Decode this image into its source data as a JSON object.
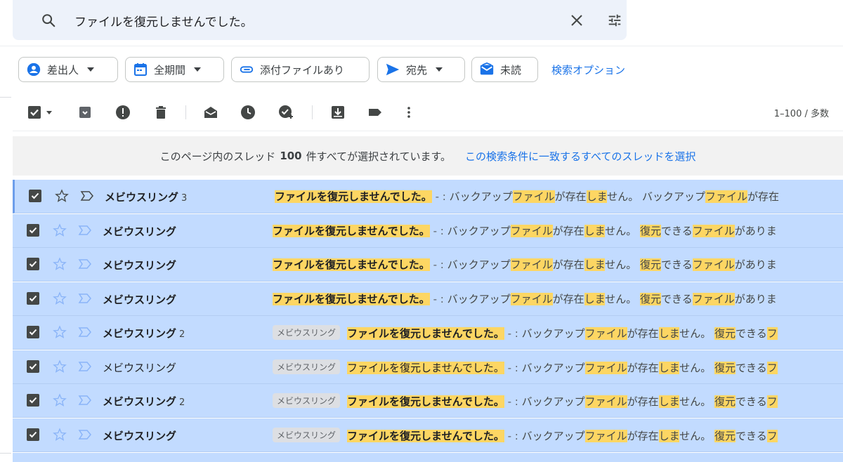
{
  "search": {
    "query": "ファイルを復元しませんでした。"
  },
  "chips": {
    "from": "差出人",
    "date": "全期間",
    "attachment": "添付ファイルあり",
    "to": "宛先",
    "unread": "未読"
  },
  "search_options": "検索オプション",
  "toolbar": {
    "range": "1–100 / 多数"
  },
  "banner": {
    "prefix": "このページ内のスレッド",
    "count": "100",
    "suffix": "件すべてが選択されています。",
    "select_all": "この検索条件に一致するすべてのスレッドを選択"
  },
  "rows": [
    {
      "sender": "メビウスリング",
      "count": "3",
      "bold": true,
      "label": "",
      "subject": "ファイルを復元しませんでした。",
      "dash": " - : ",
      "snippet_a": "バックアップ",
      "kw1": "ファイル",
      "snippet_b": "が存在",
      "kw2": "しま",
      "snippet_c": "せ",
      "snippet_d": "ん。 バックアップ",
      "kw3": "ファイル",
      "snippet_e": "が存在"
    },
    {
      "sender": "メビウスリング",
      "count": "",
      "bold": true,
      "label": "",
      "subject": "ファイルを復元しませんでした。",
      "dash": " - : ",
      "snippet_a": "バックアップ",
      "kw1": "ファイル",
      "snippet_b": "が存在",
      "kw2": "しま",
      "snippet_c": "せ",
      "snippet_d": "ん。 ",
      "kw3": "復元",
      "snippet_e": "できる",
      "kw4": "ファイル",
      "snippet_f": "がありま"
    },
    {
      "sender": "メビウスリング",
      "count": "",
      "bold": true,
      "label": "",
      "subject": "ファイルを復元しませんでした。",
      "dash": " - : ",
      "snippet_a": "バックアップ",
      "kw1": "ファイル",
      "snippet_b": "が存在",
      "kw2": "しま",
      "snippet_c": "せ",
      "snippet_d": "ん。 ",
      "kw3": "復元",
      "snippet_e": "できる",
      "kw4": "ファイル",
      "snippet_f": "がありま"
    },
    {
      "sender": "メビウスリング",
      "count": "",
      "bold": true,
      "label": "",
      "subject": "ファイルを復元しませんでした。",
      "dash": " - : ",
      "snippet_a": "バックアップ",
      "kw1": "ファイル",
      "snippet_b": "が存在",
      "kw2": "しま",
      "snippet_c": "せ",
      "snippet_d": "ん。 ",
      "kw3": "復元",
      "snippet_e": "できる",
      "kw4": "ファイル",
      "snippet_f": "がありま"
    },
    {
      "sender": "メビウスリング",
      "count": "2",
      "bold": true,
      "label": "メビウスリング",
      "subject": "ファイルを復元しませんでした。",
      "dash": " - : ",
      "snippet_a": "バックアップ",
      "kw1": "ファイル",
      "snippet_b": "が存在",
      "kw2": "しま",
      "snippet_c": "せ",
      "snippet_d": "ん。 ",
      "kw3": "復元",
      "snippet_e": "できる",
      "kw4": "フ",
      "snippet_f": ""
    },
    {
      "sender": "メビウスリング",
      "count": "",
      "bold": false,
      "label": "メビウスリング",
      "subject": "ファイルを復元しませんでした。",
      "dash": " - : ",
      "snippet_a": "バックアップ",
      "kw1": "ファイル",
      "snippet_b": "が存在",
      "kw2": "しま",
      "snippet_c": "せ",
      "snippet_d": "ん。 ",
      "kw3": "復元",
      "snippet_e": "できる",
      "kw4": "フ",
      "snippet_f": ""
    },
    {
      "sender": "メビウスリング",
      "count": "2",
      "bold": true,
      "label": "メビウスリング",
      "subject": "ファイルを復元しませんでした。",
      "dash": " - : ",
      "snippet_a": "バックアップ",
      "kw1": "ファイル",
      "snippet_b": "が存在",
      "kw2": "しま",
      "snippet_c": "せ",
      "snippet_d": "ん。 ",
      "kw3": "復元",
      "snippet_e": "できる",
      "kw4": "フ",
      "snippet_f": ""
    },
    {
      "sender": "メビウスリング",
      "count": "",
      "bold": true,
      "label": "メビウスリング",
      "subject": "ファイルを復元しませんでした。",
      "dash": " - : ",
      "snippet_a": "バックアップ",
      "kw1": "ファイル",
      "snippet_b": "が存在",
      "kw2": "しま",
      "snippet_c": "せ",
      "snippet_d": "ん。 ",
      "kw3": "復元",
      "snippet_e": "できる",
      "kw4": "フ",
      "snippet_f": ""
    }
  ],
  "colors": {
    "selected_row": "#c2dbff",
    "highlight": "#fdd663",
    "link": "#1a73e8"
  }
}
